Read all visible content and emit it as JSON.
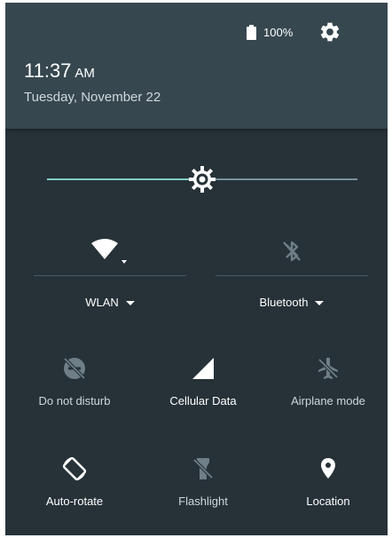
{
  "status": {
    "battery_text": "100%",
    "time": "11:37",
    "ampm": "AM",
    "date": "Tuesday, November 22"
  },
  "brightness": {
    "level": 0.5
  },
  "network_tiles": [
    {
      "label": "WLAN",
      "icon": "wifi-icon",
      "enabled": true
    },
    {
      "label": "Bluetooth",
      "icon": "bluetooth-disabled-icon",
      "enabled": false
    }
  ],
  "tiles": [
    {
      "label": "Do not disturb",
      "icon": "do-not-disturb-off-icon",
      "enabled": false
    },
    {
      "label": "Cellular Data",
      "icon": "cellular-signal-icon",
      "enabled": true
    },
    {
      "label": "Airplane mode",
      "icon": "airplane-off-icon",
      "enabled": false
    },
    {
      "label": "Auto-rotate",
      "icon": "auto-rotate-icon",
      "enabled": true
    },
    {
      "label": "Flashlight",
      "icon": "flashlight-off-icon",
      "enabled": false
    },
    {
      "label": "Location",
      "icon": "location-pin-icon",
      "enabled": true
    }
  ],
  "colors": {
    "panel_background": "#263238",
    "header_background": "#37474f",
    "accent": "#80cbc4",
    "icon_active": "#ffffff",
    "icon_inactive": "#6f7f87"
  }
}
